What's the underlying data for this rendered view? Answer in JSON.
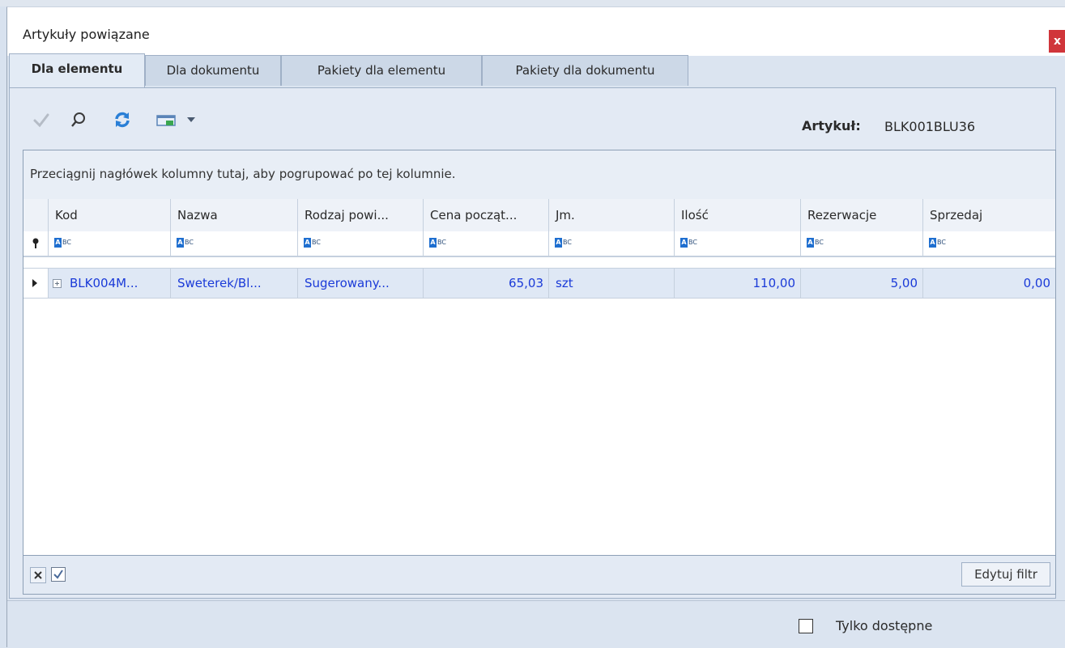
{
  "window": {
    "title": "Artykuły powiązane",
    "close_label": "x"
  },
  "tabs": [
    {
      "label": "Dla elementu",
      "active": true
    },
    {
      "label": "Dla dokumentu",
      "active": false
    },
    {
      "label": "Pakiety dla elementu",
      "active": false
    },
    {
      "label": "Pakiety dla dokumentu",
      "active": false
    }
  ],
  "toolbar": {
    "icons": [
      "check-icon",
      "search-icon",
      "refresh-icon",
      "export-icon",
      "dropdown-arrow-icon"
    ],
    "artykul_label": "Artykuł:",
    "artykul_value": "BLK001BLU36"
  },
  "grid": {
    "group_hint": "Przeciągnij nagłówek kolumny tutaj, aby pogrupować po tej kolumnie.",
    "columns": [
      "Kod",
      "Nazwa",
      "Rodzaj powi...",
      "Cena począt...",
      "Jm.",
      "Ilość",
      "Rezerwacje",
      "Sprzedaj"
    ],
    "filter_placeholder_icon": "text-filter-icon",
    "rows": [
      {
        "kod": "BLK004M...",
        "nazwa": "Sweterek/Bl...",
        "rodzaj": "Sugerowany...",
        "cena": "65,03",
        "jm": "szt",
        "ilosc": "110,00",
        "rezerwacje": "5,00",
        "sprzedaj": "0,00"
      }
    ]
  },
  "footer": {
    "edit_filter_label": "Edytuj filtr",
    "only_available_label": "Tylko dostępne",
    "only_available_checked": false
  },
  "colors": {
    "accent_close": "#d0353a",
    "link_text": "#1a3ad8",
    "panel_bg": "#e3eaf4"
  }
}
